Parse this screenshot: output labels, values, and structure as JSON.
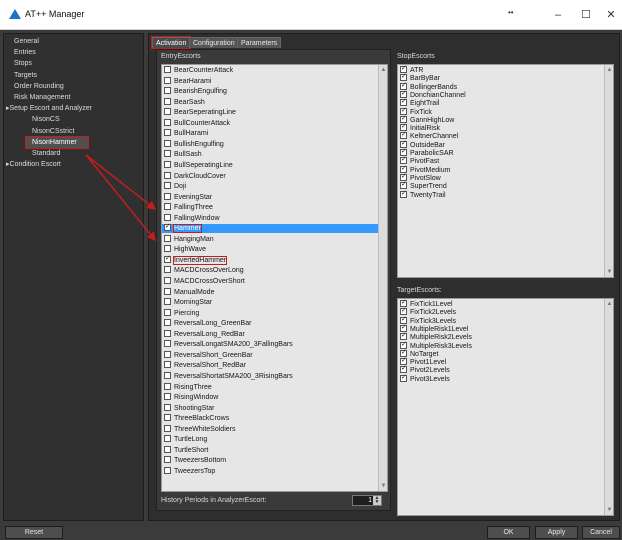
{
  "window": {
    "title": "AT++ Manager",
    "icon": "triangle-app-icon",
    "controls": {
      "grip": "••",
      "minimize": "–",
      "maximize": "☐",
      "close": "✕"
    }
  },
  "tree": {
    "items": [
      {
        "label": "General",
        "level": 0,
        "selected": false
      },
      {
        "label": "Entries",
        "level": 0,
        "selected": false
      },
      {
        "label": "Stops",
        "level": 0,
        "selected": false
      },
      {
        "label": "Targets",
        "level": 0,
        "selected": false
      },
      {
        "label": "Order Rounding",
        "level": 0,
        "selected": false
      },
      {
        "label": "Risk Management",
        "level": 0,
        "selected": false
      },
      {
        "label": "Setup Escort and Analyzer",
        "level": 0,
        "expander": "▸",
        "selected": false
      },
      {
        "label": "NisonCS",
        "level": 2,
        "selected": false
      },
      {
        "label": "NisonCSstrict",
        "level": 2,
        "selected": false
      },
      {
        "label": "NisonHammer",
        "level": 2,
        "selected": true
      },
      {
        "label": "Standard",
        "level": 2,
        "selected": false
      },
      {
        "label": "Condition Escort",
        "level": 0,
        "expander": "▸",
        "selected": false
      }
    ]
  },
  "tabs": [
    {
      "label": "Activation",
      "active": true
    },
    {
      "label": "Configuration",
      "active": false
    },
    {
      "label": "Parameters",
      "active": false
    }
  ],
  "entry_escorts": {
    "label": "EntryEscorts",
    "items": [
      {
        "label": "BearCounterAttack",
        "checked": false
      },
      {
        "label": "BearHarami",
        "checked": false
      },
      {
        "label": "BearishEngulfing",
        "checked": false
      },
      {
        "label": "BearSash",
        "checked": false
      },
      {
        "label": "BearSeperatingLine",
        "checked": false
      },
      {
        "label": "BullCounterAttack",
        "checked": false
      },
      {
        "label": "BullHarami",
        "checked": false
      },
      {
        "label": "BullishEngulfing",
        "checked": false
      },
      {
        "label": "BullSash",
        "checked": false
      },
      {
        "label": "BullSeperatingLine",
        "checked": false
      },
      {
        "label": "DarkCloudCover",
        "checked": false
      },
      {
        "label": "Doji",
        "checked": false
      },
      {
        "label": "EveningStar",
        "checked": false
      },
      {
        "label": "FallingThree",
        "checked": false
      },
      {
        "label": "FallingWindow",
        "checked": false
      },
      {
        "label": "Hammer",
        "checked": true,
        "selected": true,
        "boxed": true
      },
      {
        "label": "HangingMan",
        "checked": false
      },
      {
        "label": "HighWave",
        "checked": false
      },
      {
        "label": "InvertedHammer",
        "checked": true,
        "boxed": true
      },
      {
        "label": "MACDCrossOverLong",
        "checked": false
      },
      {
        "label": "MACDCrossOverShort",
        "checked": false
      },
      {
        "label": "ManualMode",
        "checked": false
      },
      {
        "label": "MorningStar",
        "checked": false
      },
      {
        "label": "Piercing",
        "checked": false
      },
      {
        "label": "ReversalLong_GreenBar",
        "checked": false
      },
      {
        "label": "ReversalLong_RedBar",
        "checked": false
      },
      {
        "label": "ReversalLongatSMA200_3FallingBars",
        "checked": false
      },
      {
        "label": "ReversalShort_GreenBar",
        "checked": false
      },
      {
        "label": "ReversalShort_RedBar",
        "checked": false
      },
      {
        "label": "ReversalShortatSMA200_3RisingBars",
        "checked": false
      },
      {
        "label": "RisingThree",
        "checked": false
      },
      {
        "label": "RisingWindow",
        "checked": false
      },
      {
        "label": "ShootingStar",
        "checked": false
      },
      {
        "label": "ThreeBlackCrows",
        "checked": false
      },
      {
        "label": "ThreeWhiteSoldiers",
        "checked": false
      },
      {
        "label": "TurtleLong",
        "checked": false
      },
      {
        "label": "TurtleShort",
        "checked": false
      },
      {
        "label": "TweezersBottom",
        "checked": false
      },
      {
        "label": "TweezersTop",
        "checked": false
      }
    ]
  },
  "stop_escorts": {
    "label": "StopEscorts",
    "items": [
      {
        "label": "ATR",
        "checked": true
      },
      {
        "label": "BarByBar",
        "checked": true
      },
      {
        "label": "BollingerBands",
        "checked": true
      },
      {
        "label": "DonchianChannel",
        "checked": true
      },
      {
        "label": "EightTrail",
        "checked": true
      },
      {
        "label": "FixTick",
        "checked": true
      },
      {
        "label": "GannHighLow",
        "checked": true
      },
      {
        "label": "InitialRisk",
        "checked": true
      },
      {
        "label": "KeltnerChannel",
        "checked": true
      },
      {
        "label": "OutsideBar",
        "checked": true
      },
      {
        "label": "ParabolicSAR",
        "checked": true
      },
      {
        "label": "PivotFast",
        "checked": true
      },
      {
        "label": "PivotMedium",
        "checked": true
      },
      {
        "label": "PivotSlow",
        "checked": true
      },
      {
        "label": "SuperTrend",
        "checked": true
      },
      {
        "label": "TwentyTrail",
        "checked": true
      }
    ]
  },
  "target_escorts": {
    "label": "TargetEscorts:",
    "items": [
      {
        "label": "FixTick1Level",
        "checked": true
      },
      {
        "label": "FixTick2Levels",
        "checked": true
      },
      {
        "label": "FixTick3Levels",
        "checked": true
      },
      {
        "label": "MultipleRisk1Level",
        "checked": true
      },
      {
        "label": "MultipleRisk2Levels",
        "checked": true
      },
      {
        "label": "MultipleRisk3Levels",
        "checked": true
      },
      {
        "label": "NoTarget",
        "checked": true
      },
      {
        "label": "Pivot1Level",
        "checked": true
      },
      {
        "label": "Pivot2Levels",
        "checked": true
      },
      {
        "label": "Pivot3Levels",
        "checked": true
      }
    ]
  },
  "history": {
    "label": "History Periods in AnalyzerEscort:",
    "value": "1"
  },
  "buttons": {
    "reset": "Reset",
    "ok": "OK",
    "apply": "Apply",
    "cancel": "Cancel"
  },
  "colors": {
    "selection": "#3399ff",
    "highlight_box": "#c41d1d",
    "annotation_arrow": "#c41d1d"
  }
}
